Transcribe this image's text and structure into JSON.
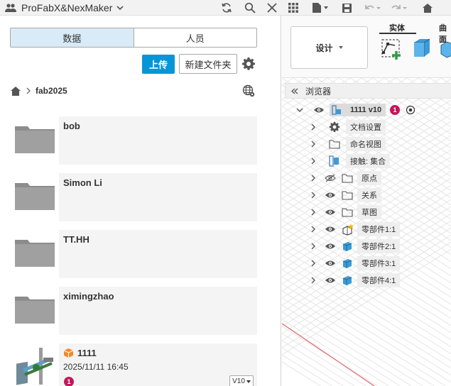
{
  "app": {
    "title": "ProFabX&NexMaker"
  },
  "left_panel": {
    "tabs": [
      {
        "label": "数据",
        "active": true
      },
      {
        "label": "人员",
        "active": false
      }
    ],
    "upload_label": "上传",
    "new_folder_label": "新建文件夹",
    "breadcrumb": {
      "project": "fab2025"
    },
    "items": [
      {
        "name": "bob",
        "type": "folder"
      },
      {
        "name": "Simon Li",
        "type": "folder"
      },
      {
        "name": "TT.HH",
        "type": "folder"
      },
      {
        "name": "ximingzhao",
        "type": "folder"
      },
      {
        "name": "1111",
        "type": "design",
        "date": "2025/11/11 16:45",
        "badge": "1",
        "version": "V10"
      }
    ]
  },
  "right_panel": {
    "design_menu_label": "设计",
    "tabs": [
      "实体",
      "曲面"
    ],
    "browser_title": "浏览器",
    "root": {
      "label": "1111 v10",
      "badge": "1"
    },
    "tree": [
      {
        "label": "文档设置",
        "icon": "gear-icon"
      },
      {
        "label": "命名视图",
        "icon": "folder-icon"
      },
      {
        "label": "接触: 集合",
        "icon": "contact-sets-icon"
      },
      {
        "label": "原点",
        "icon": "folder-icon",
        "hidden": true
      },
      {
        "label": "关系",
        "icon": "folder-icon"
      },
      {
        "label": "草图",
        "icon": "folder-icon"
      },
      {
        "label": "零部件1:1",
        "icon": "component-active-icon"
      },
      {
        "label": "零部件2:1",
        "icon": "component-icon"
      },
      {
        "label": "零部件3:1",
        "icon": "component-icon"
      },
      {
        "label": "零部件4:1",
        "icon": "component-icon"
      }
    ]
  },
  "colors": {
    "accent": "#0696d7",
    "active_tab": "#d8ebf7",
    "badge": "#c2185b",
    "component_blue": "#3c9bd6",
    "axis_red": "#e06666"
  }
}
